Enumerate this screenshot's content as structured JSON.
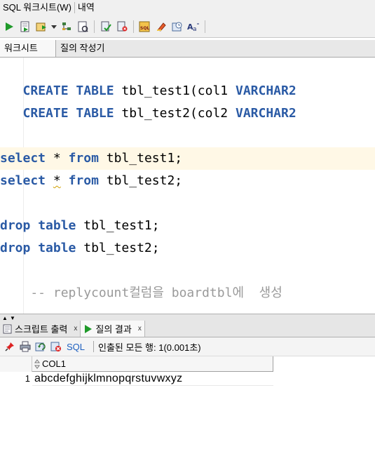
{
  "topbar": {
    "tab_worksheet": "SQL 워크시트(W)",
    "tab_history": "내역"
  },
  "toolbar": {
    "icons": [
      "run-statement-icon",
      "run-script-icon",
      "commit-icon",
      "dropdown-icon",
      "explain-plan-icon",
      "autotrace-icon",
      "commit-transaction-icon",
      "rollback-icon",
      "sql-tuning-icon",
      "clear-icon",
      "history-icon",
      "format-icon"
    ]
  },
  "worksheet_tabs": {
    "worksheet": "워크시트",
    "query_builder": "질의 작성기"
  },
  "editor": {
    "lines": [
      {
        "indent": "   ",
        "k1": "CREATE",
        "k2": "TABLE",
        "t1": "tbl_test1(col1",
        "k3": "VARCHAR2"
      },
      {
        "indent": "   ",
        "k1": "CREATE",
        "k2": "TABLE",
        "t1": "tbl_test2(col2",
        "k3": "VARCHAR2"
      },
      {
        "k1": "select",
        "t1": "*",
        "k2": "from",
        "t2": "tbl_test1;"
      },
      {
        "k1": "select",
        "t1": "*",
        "k2": "from",
        "t2": "tbl_test2;"
      },
      {
        "k1": "drop",
        "k2": "table",
        "t1": "tbl_test1;"
      },
      {
        "k1": "drop",
        "k2": "table",
        "t1": "tbl_test2;"
      },
      {
        "comment": "    -- replycount컬럼을 boardtbl에  생성"
      }
    ],
    "current_line": 3
  },
  "results_tabs": {
    "script_output": "스크립트 출력",
    "query_result": "질의 결과",
    "close_label": "x"
  },
  "results_toolbar": {
    "sql_label": "SQL",
    "status": "인출된 모든 행: 1(0.001초)"
  },
  "grid": {
    "columns": [
      "COL1"
    ],
    "rows": [
      {
        "num": "1",
        "values": [
          "abcdefghijklmnopqrstuvwxyz"
        ]
      }
    ]
  },
  "colors": {
    "keyword": "#2a5aa5",
    "comment": "#9a9a9a",
    "current_line": "#fff8e6",
    "sql_link": "#1d5fbf"
  }
}
